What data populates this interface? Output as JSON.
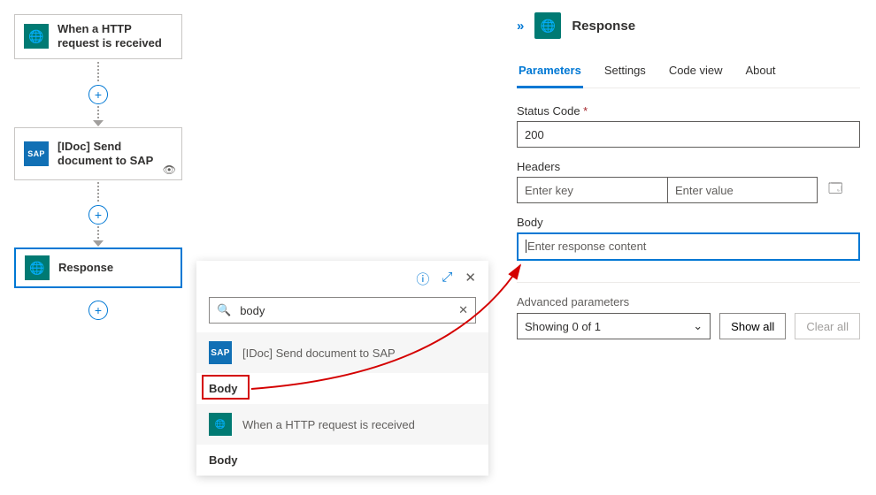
{
  "workflow": {
    "nodes": [
      {
        "label": "When a HTTP request is received",
        "icon": "globe"
      },
      {
        "label": "[IDoc] Send document to SAP",
        "icon": "sap"
      },
      {
        "label": "Response",
        "icon": "globe"
      }
    ]
  },
  "picker": {
    "search_value": "body",
    "groups": [
      {
        "title": "[IDoc] Send document to SAP",
        "icon": "sap",
        "token": "Body"
      },
      {
        "title": "When a HTTP request is received",
        "icon": "globe",
        "token": "Body"
      }
    ]
  },
  "panel": {
    "title": "Response",
    "tabs": {
      "parameters": "Parameters",
      "settings": "Settings",
      "codeview": "Code view",
      "about": "About"
    },
    "fields": {
      "status_label": "Status Code",
      "status_value": "200",
      "headers_label": "Headers",
      "headers_key_placeholder": "Enter key",
      "headers_value_placeholder": "Enter value",
      "body_label": "Body",
      "body_placeholder": "Enter response content",
      "adv_label": "Advanced parameters",
      "adv_select": "Showing 0 of 1",
      "show_all": "Show all",
      "clear_all": "Clear all"
    }
  }
}
